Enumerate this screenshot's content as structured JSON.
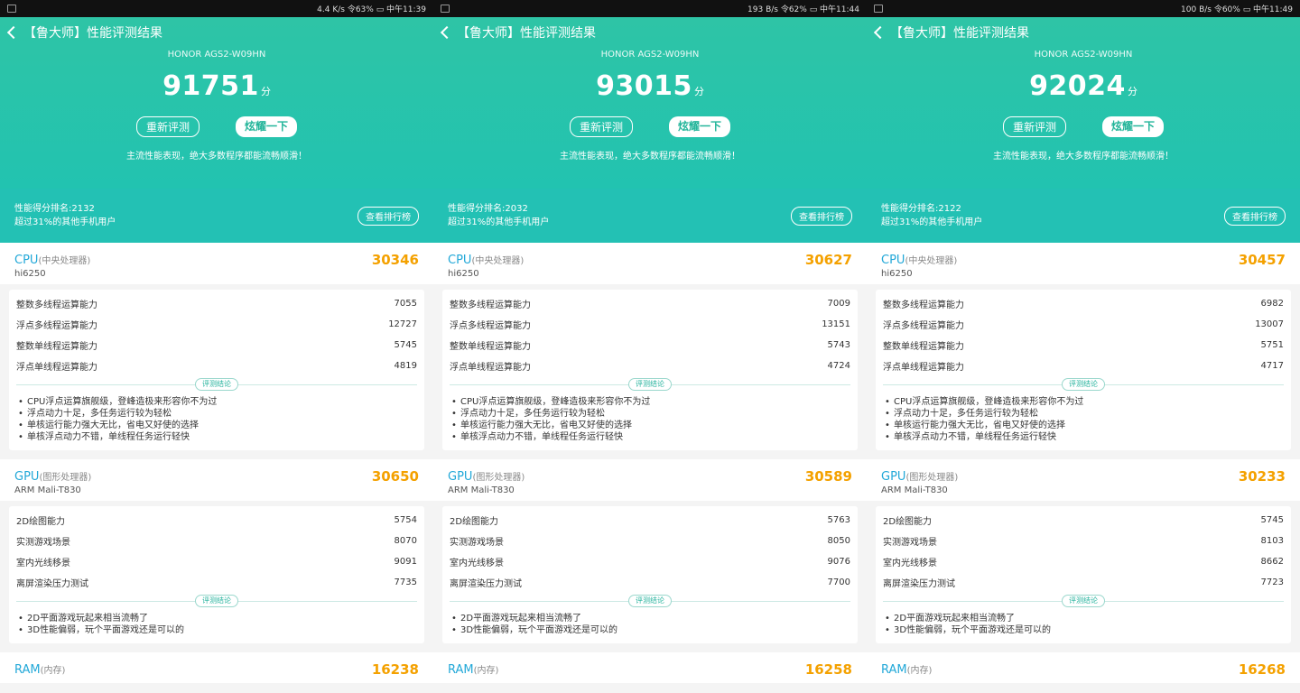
{
  "panels": [
    {
      "statusbar": {
        "right": "4.4 K/s 令63% ▭ 中午11:39"
      },
      "title": "【鲁大师】性能评测结果",
      "model": "HONOR AGS2-W09HN",
      "score": "91751",
      "score_unit": "分",
      "retest_label": "重新评测",
      "share_label": "炫耀一下",
      "slogan": "主流性能表现，绝大多数程序都能流畅顺滑！",
      "rank_text": "性能得分排名:2132",
      "rank_sub": "超过31%的其他手机用户",
      "rank_button": "查看排行榜",
      "cpu": {
        "name": "CPU",
        "sub": "(中央处理器)",
        "chip": "hi6250",
        "score": "30346",
        "rows": [
          {
            "label": "整数多线程运算能力",
            "value": "7055"
          },
          {
            "label": "浮点多线程运算能力",
            "value": "12727"
          },
          {
            "label": "整数单线程运算能力",
            "value": "5745"
          },
          {
            "label": "浮点单线程运算能力",
            "value": "4819"
          }
        ],
        "conclusion_label": "评测结论",
        "bullets": [
          "CPU浮点运算旗舰级，登峰造极来形容你不为过",
          "浮点动力十足，多任务运行较为轻松",
          "单核运行能力强大无比，省电又好使的选择",
          "单核浮点动力不错，单线程任务运行轻快"
        ]
      },
      "gpu": {
        "name": "GPU",
        "sub": "(图形处理器)",
        "chip": "ARM Mali-T830",
        "score": "30650",
        "rows": [
          {
            "label": "2D绘图能力",
            "value": "5754"
          },
          {
            "label": "实测游戏场景",
            "value": "8070"
          },
          {
            "label": "室内光线移景",
            "value": "9091"
          },
          {
            "label": "离屏渲染压力测试",
            "value": "7735"
          }
        ],
        "conclusion_label": "评测结论",
        "bullets": [
          "2D平面游戏玩起来相当流畅了",
          "3D性能偏弱，玩个平面游戏还是可以的"
        ]
      },
      "ram": {
        "name": "RAM",
        "sub": "(内存)",
        "score": "16238"
      }
    },
    {
      "statusbar": {
        "right": "193 B/s 令62% ▭ 中午11:44"
      },
      "title": "【鲁大师】性能评测结果",
      "model": "HONOR AGS2-W09HN",
      "score": "93015",
      "score_unit": "分",
      "retest_label": "重新评测",
      "share_label": "炫耀一下",
      "slogan": "主流性能表现，绝大多数程序都能流畅顺滑！",
      "rank_text": "性能得分排名:2032",
      "rank_sub": "超过31%的其他手机用户",
      "rank_button": "查看排行榜",
      "cpu": {
        "name": "CPU",
        "sub": "(中央处理器)",
        "chip": "hi6250",
        "score": "30627",
        "rows": [
          {
            "label": "整数多线程运算能力",
            "value": "7009"
          },
          {
            "label": "浮点多线程运算能力",
            "value": "13151"
          },
          {
            "label": "整数单线程运算能力",
            "value": "5743"
          },
          {
            "label": "浮点单线程运算能力",
            "value": "4724"
          }
        ],
        "conclusion_label": "评测结论",
        "bullets": [
          "CPU浮点运算旗舰级，登峰造极来形容你不为过",
          "浮点动力十足，多任务运行较为轻松",
          "单核运行能力强大无比，省电又好使的选择",
          "单核浮点动力不错，单线程任务运行轻快"
        ]
      },
      "gpu": {
        "name": "GPU",
        "sub": "(图形处理器)",
        "chip": "ARM Mali-T830",
        "score": "30589",
        "rows": [
          {
            "label": "2D绘图能力",
            "value": "5763"
          },
          {
            "label": "实测游戏场景",
            "value": "8050"
          },
          {
            "label": "室内光线移景",
            "value": "9076"
          },
          {
            "label": "离屏渲染压力测试",
            "value": "7700"
          }
        ],
        "conclusion_label": "评测结论",
        "bullets": [
          "2D平面游戏玩起来相当流畅了",
          "3D性能偏弱，玩个平面游戏还是可以的"
        ]
      },
      "ram": {
        "name": "RAM",
        "sub": "(内存)",
        "score": "16258"
      }
    },
    {
      "statusbar": {
        "right": "100 B/s 令60% ▭ 中午11:49"
      },
      "title": "【鲁大师】性能评测结果",
      "model": "HONOR AGS2-W09HN",
      "score": "92024",
      "score_unit": "分",
      "retest_label": "重新评测",
      "share_label": "炫耀一下",
      "slogan": "主流性能表现，绝大多数程序都能流畅顺滑！",
      "rank_text": "性能得分排名:2122",
      "rank_sub": "超过31%的其他手机用户",
      "rank_button": "查看排行榜",
      "cpu": {
        "name": "CPU",
        "sub": "(中央处理器)",
        "chip": "hi6250",
        "score": "30457",
        "rows": [
          {
            "label": "整数多线程运算能力",
            "value": "6982"
          },
          {
            "label": "浮点多线程运算能力",
            "value": "13007"
          },
          {
            "label": "整数单线程运算能力",
            "value": "5751"
          },
          {
            "label": "浮点单线程运算能力",
            "value": "4717"
          }
        ],
        "conclusion_label": "评测结论",
        "bullets": [
          "CPU浮点运算旗舰级，登峰造极来形容你不为过",
          "浮点动力十足，多任务运行较为轻松",
          "单核运行能力强大无比，省电又好使的选择",
          "单核浮点动力不错，单线程任务运行轻快"
        ]
      },
      "gpu": {
        "name": "GPU",
        "sub": "(图形处理器)",
        "chip": "ARM Mali-T830",
        "score": "30233",
        "rows": [
          {
            "label": "2D绘图能力",
            "value": "5745"
          },
          {
            "label": "实测游戏场景",
            "value": "8103"
          },
          {
            "label": "室内光线移景",
            "value": "8662"
          },
          {
            "label": "离屏渲染压力测试",
            "value": "7723"
          }
        ],
        "conclusion_label": "评测结论",
        "bullets": [
          "2D平面游戏玩起来相当流畅了",
          "3D性能偏弱，玩个平面游戏还是可以的"
        ]
      },
      "ram": {
        "name": "RAM",
        "sub": "(内存)",
        "score": "16268"
      }
    }
  ]
}
